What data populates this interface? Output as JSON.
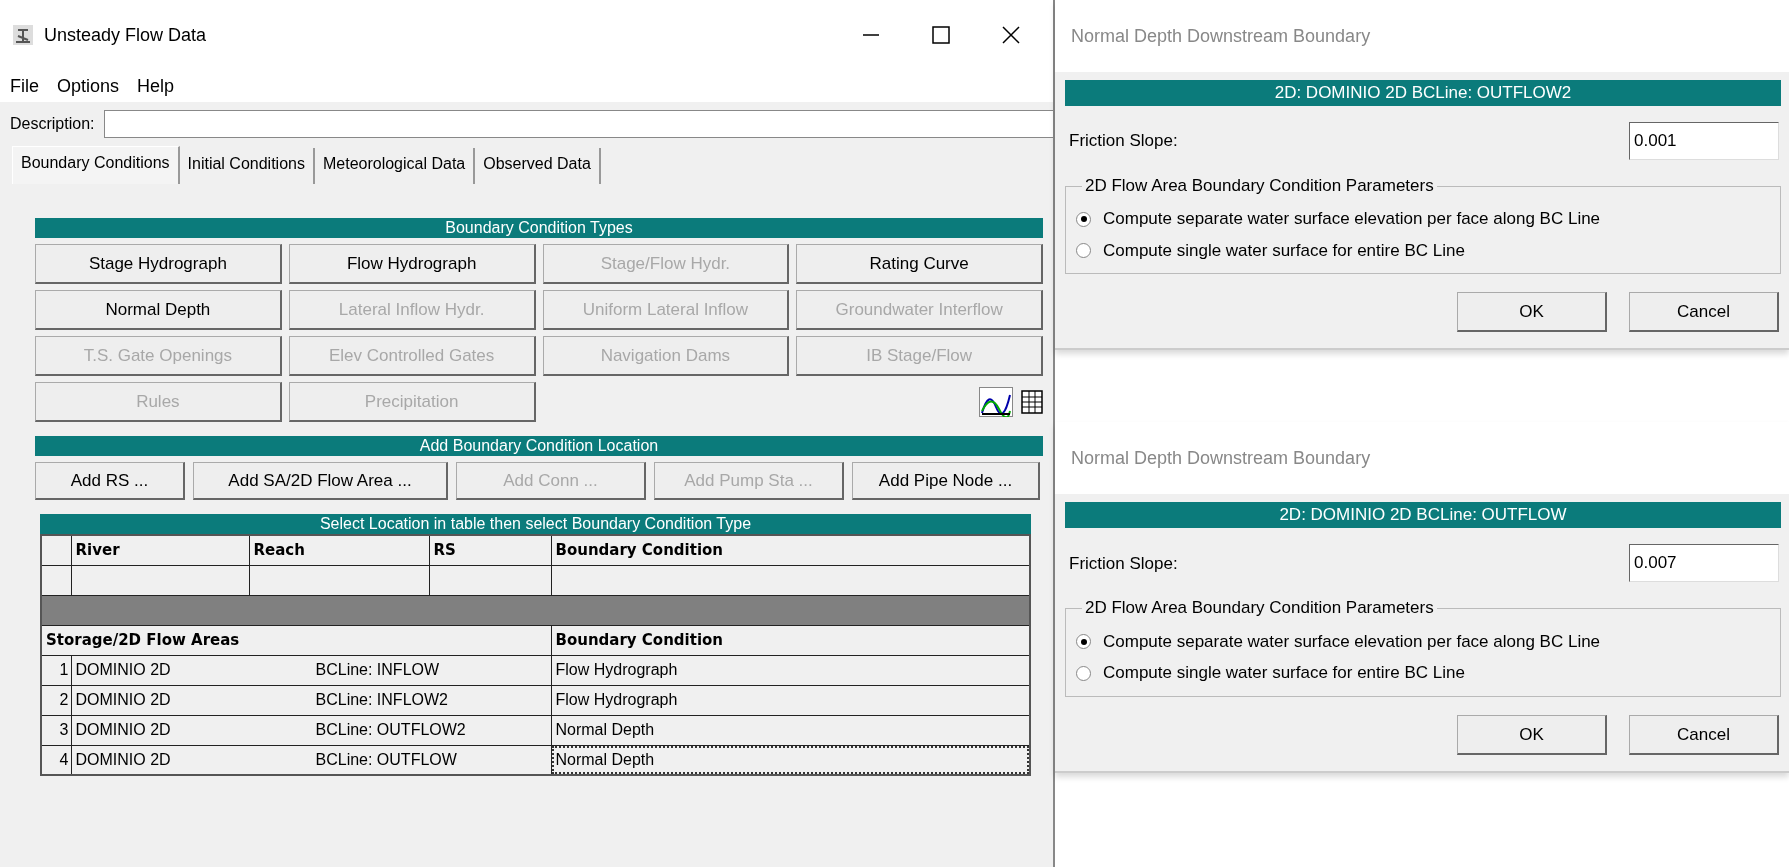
{
  "main_window": {
    "title": "Unsteady Flow Data",
    "menu": [
      "File",
      "Options",
      "Help"
    ],
    "description_label": "Description:",
    "tabs": [
      {
        "label": "Boundary Conditions",
        "selected": true
      },
      {
        "label": "Initial Conditions",
        "selected": false
      },
      {
        "label": "Meteorological Data",
        "selected": false
      },
      {
        "label": "Observed Data",
        "selected": false
      }
    ],
    "bc_types": {
      "header": "Boundary Condition Types",
      "buttons": [
        {
          "label": "Stage Hydrograph",
          "disabled": false
        },
        {
          "label": "Flow Hydrograph",
          "disabled": false
        },
        {
          "label": "Stage/Flow Hydr.",
          "disabled": true
        },
        {
          "label": "Rating Curve",
          "disabled": false
        },
        {
          "label": "Normal Depth",
          "disabled": false
        },
        {
          "label": "Lateral Inflow Hydr.",
          "disabled": true
        },
        {
          "label": "Uniform Lateral Inflow",
          "disabled": true
        },
        {
          "label": "Groundwater Interflow",
          "disabled": true
        },
        {
          "label": "T.S. Gate Openings",
          "disabled": true
        },
        {
          "label": "Elev Controlled Gates",
          "disabled": true
        },
        {
          "label": "Navigation Dams",
          "disabled": true
        },
        {
          "label": "IB Stage/Flow",
          "disabled": true
        },
        {
          "label": "Rules",
          "disabled": true
        },
        {
          "label": "Precipitation",
          "disabled": true
        }
      ]
    },
    "add_location": {
      "header": "Add Boundary Condition Location",
      "buttons": [
        {
          "label": "Add RS ...",
          "disabled": false
        },
        {
          "label": "Add SA/2D Flow Area ...",
          "disabled": false
        },
        {
          "label": "Add Conn ...",
          "disabled": true
        },
        {
          "label": "Add Pump Sta ...",
          "disabled": true
        },
        {
          "label": "Add Pipe Node ...",
          "disabled": false
        }
      ]
    },
    "table": {
      "header": "Select Location in table then select Boundary Condition Type",
      "river_columns": [
        "River",
        "Reach",
        "RS",
        "Boundary Condition"
      ],
      "area_columns": [
        "Storage/2D Flow Areas",
        "Boundary Condition"
      ],
      "rows": [
        {
          "number": "1",
          "area": "DOMINIO 2D",
          "bc_line": "BCLine: INFLOW",
          "condition": "Flow Hydrograph",
          "selected": false
        },
        {
          "number": "2",
          "area": "DOMINIO 2D",
          "bc_line": "BCLine: INFLOW2",
          "condition": "Flow Hydrograph",
          "selected": false
        },
        {
          "number": "3",
          "area": "DOMINIO 2D",
          "bc_line": "BCLine: OUTFLOW2",
          "condition": "Normal Depth",
          "selected": false
        },
        {
          "number": "4",
          "area": "DOMINIO 2D",
          "bc_line": "BCLine: OUTFLOW",
          "condition": "Normal Depth",
          "selected": true
        }
      ]
    }
  },
  "dialogs": [
    {
      "title": "Normal Depth Downstream Boundary",
      "header": "2D: DOMINIO 2D BCLine: OUTFLOW2",
      "friction_label": "Friction Slope:",
      "friction_value": "0.001",
      "group_label": "2D Flow Area Boundary Condition Parameters",
      "options": [
        {
          "label": "Compute separate water surface elevation per face along BC Line",
          "selected": true
        },
        {
          "label": "Compute single water surface for entire BC Line",
          "selected": false
        }
      ],
      "buttons": [
        "OK",
        "Cancel"
      ]
    },
    {
      "title": "Normal Depth Downstream Boundary",
      "header": "2D: DOMINIO 2D BCLine: OUTFLOW",
      "friction_label": "Friction Slope:",
      "friction_value": "0.007",
      "group_label": "2D Flow Area Boundary Condition Parameters",
      "options": [
        {
          "label": "Compute separate water surface elevation per face along BC Line",
          "selected": true
        },
        {
          "label": "Compute single water surface for entire BC Line",
          "selected": false
        }
      ],
      "buttons": [
        "OK",
        "Cancel"
      ]
    }
  ]
}
